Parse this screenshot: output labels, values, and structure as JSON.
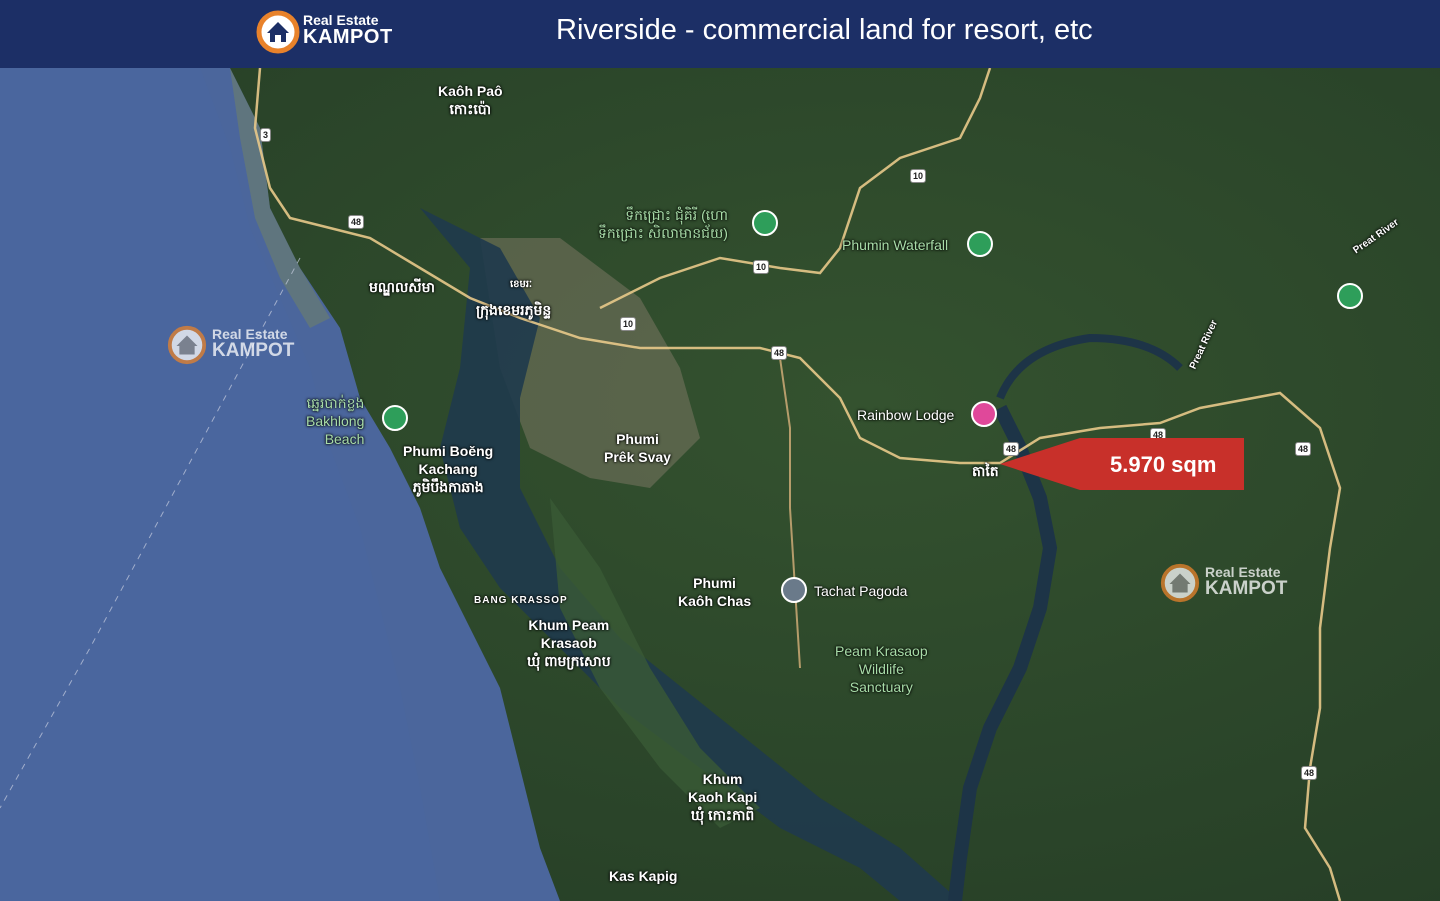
{
  "header": {
    "logo_line1": "Real Estate",
    "logo_line2": "KAMPOT",
    "title": "Riverside - commercial land for resort, etc"
  },
  "colors": {
    "header_bg": "#1c2f66",
    "logo_orange": "#e8822b",
    "sea": "#4d6aa0",
    "land": "#2f4a2f",
    "callout_red": "#c8302a",
    "road": "#e8c98a"
  },
  "callout": {
    "label": "5.970 sqm",
    "icon": "red-arrow-callout"
  },
  "places": {
    "kaoh_pao_en": "Kaôh Paô",
    "kaoh_pao_km": "កោះប៉ោ",
    "waterfall_km1": "ទឹកជ្រោះ ជុំគិរី (ហោ",
    "waterfall_km2": "ទឹកជ្រោះ សិលាមានជ័យ)",
    "phumin_waterfall": "Phumin Waterfall",
    "preat_river_1": "Preat River",
    "preat_river_2": "Preat River",
    "mondolseima": "មណ្ឌលសីមា",
    "kampot_city_km": "ក្រុងខេមរភូមិន្ទ",
    "kampot_small": "ខេមរៈ",
    "bakhlong_km": "ឆ្នេរបាក់ខ្លង",
    "bakhlong_1": "Bakhlong",
    "bakhlong_2": "Beach",
    "boeng_1": "Phumi Boĕng",
    "boeng_2": "Kachang",
    "boeng_km": "ភូមិបឹងកាឆាង",
    "prek_svay_1": "Phumi",
    "prek_svay_2": "Prêk Svay",
    "rainbow_lodge": "Rainbow Lodge",
    "tatai_km": "តាតៃ",
    "bang_krassop": "BANG KRASSOP",
    "kaoh_chas_1": "Phumi",
    "kaoh_chas_2": "Kaôh Chas",
    "tachat_pagoda": "Tachat Pagoda",
    "peam_1": "Khum Peam",
    "peam_2": "Krasaob",
    "peam_km": "ឃុំ ពាមក្រសោប",
    "sanctuary_1": "Peam Krasaop",
    "sanctuary_2": "Wildlife",
    "sanctuary_3": "Sanctuary",
    "kapi_1": "Khum",
    "kapi_2": "Kaoh Kapi",
    "kapi_km": "ឃុំ កោះកាពិ",
    "kas_kapig": "Kas Kapig"
  },
  "road_shields": [
    "3",
    "48",
    "10",
    "10",
    "10",
    "48",
    "48",
    "48",
    "48",
    "48"
  ],
  "watermarks": [
    {
      "line1": "Real Estate",
      "line2": "KAMPOT"
    },
    {
      "line1": "Real Estate",
      "line2": "KAMPOT"
    }
  ]
}
